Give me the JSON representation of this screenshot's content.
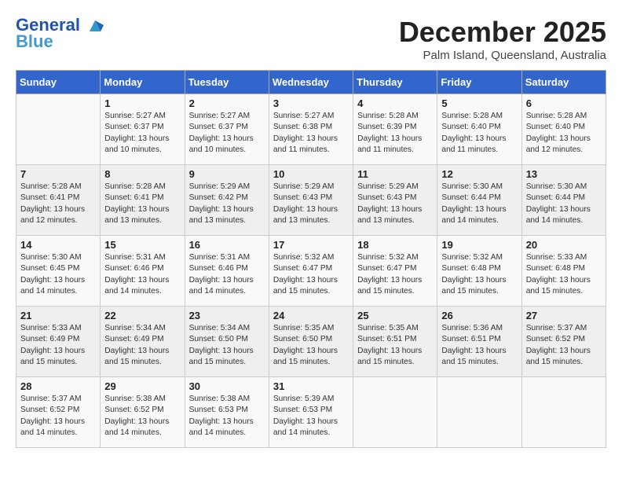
{
  "header": {
    "logo_line1": "General",
    "logo_line2": "Blue",
    "month": "December 2025",
    "location": "Palm Island, Queensland, Australia"
  },
  "weekdays": [
    "Sunday",
    "Monday",
    "Tuesday",
    "Wednesday",
    "Thursday",
    "Friday",
    "Saturday"
  ],
  "weeks": [
    [
      {
        "day": "",
        "info": ""
      },
      {
        "day": "1",
        "info": "Sunrise: 5:27 AM\nSunset: 6:37 PM\nDaylight: 13 hours\nand 10 minutes."
      },
      {
        "day": "2",
        "info": "Sunrise: 5:27 AM\nSunset: 6:37 PM\nDaylight: 13 hours\nand 10 minutes."
      },
      {
        "day": "3",
        "info": "Sunrise: 5:27 AM\nSunset: 6:38 PM\nDaylight: 13 hours\nand 11 minutes."
      },
      {
        "day": "4",
        "info": "Sunrise: 5:28 AM\nSunset: 6:39 PM\nDaylight: 13 hours\nand 11 minutes."
      },
      {
        "day": "5",
        "info": "Sunrise: 5:28 AM\nSunset: 6:40 PM\nDaylight: 13 hours\nand 11 minutes."
      },
      {
        "day": "6",
        "info": "Sunrise: 5:28 AM\nSunset: 6:40 PM\nDaylight: 13 hours\nand 12 minutes."
      }
    ],
    [
      {
        "day": "7",
        "info": "Sunrise: 5:28 AM\nSunset: 6:41 PM\nDaylight: 13 hours\nand 12 minutes."
      },
      {
        "day": "8",
        "info": "Sunrise: 5:28 AM\nSunset: 6:41 PM\nDaylight: 13 hours\nand 13 minutes."
      },
      {
        "day": "9",
        "info": "Sunrise: 5:29 AM\nSunset: 6:42 PM\nDaylight: 13 hours\nand 13 minutes."
      },
      {
        "day": "10",
        "info": "Sunrise: 5:29 AM\nSunset: 6:43 PM\nDaylight: 13 hours\nand 13 minutes."
      },
      {
        "day": "11",
        "info": "Sunrise: 5:29 AM\nSunset: 6:43 PM\nDaylight: 13 hours\nand 13 minutes."
      },
      {
        "day": "12",
        "info": "Sunrise: 5:30 AM\nSunset: 6:44 PM\nDaylight: 13 hours\nand 14 minutes."
      },
      {
        "day": "13",
        "info": "Sunrise: 5:30 AM\nSunset: 6:44 PM\nDaylight: 13 hours\nand 14 minutes."
      }
    ],
    [
      {
        "day": "14",
        "info": "Sunrise: 5:30 AM\nSunset: 6:45 PM\nDaylight: 13 hours\nand 14 minutes."
      },
      {
        "day": "15",
        "info": "Sunrise: 5:31 AM\nSunset: 6:46 PM\nDaylight: 13 hours\nand 14 minutes."
      },
      {
        "day": "16",
        "info": "Sunrise: 5:31 AM\nSunset: 6:46 PM\nDaylight: 13 hours\nand 14 minutes."
      },
      {
        "day": "17",
        "info": "Sunrise: 5:32 AM\nSunset: 6:47 PM\nDaylight: 13 hours\nand 15 minutes."
      },
      {
        "day": "18",
        "info": "Sunrise: 5:32 AM\nSunset: 6:47 PM\nDaylight: 13 hours\nand 15 minutes."
      },
      {
        "day": "19",
        "info": "Sunrise: 5:32 AM\nSunset: 6:48 PM\nDaylight: 13 hours\nand 15 minutes."
      },
      {
        "day": "20",
        "info": "Sunrise: 5:33 AM\nSunset: 6:48 PM\nDaylight: 13 hours\nand 15 minutes."
      }
    ],
    [
      {
        "day": "21",
        "info": "Sunrise: 5:33 AM\nSunset: 6:49 PM\nDaylight: 13 hours\nand 15 minutes."
      },
      {
        "day": "22",
        "info": "Sunrise: 5:34 AM\nSunset: 6:49 PM\nDaylight: 13 hours\nand 15 minutes."
      },
      {
        "day": "23",
        "info": "Sunrise: 5:34 AM\nSunset: 6:50 PM\nDaylight: 13 hours\nand 15 minutes."
      },
      {
        "day": "24",
        "info": "Sunrise: 5:35 AM\nSunset: 6:50 PM\nDaylight: 13 hours\nand 15 minutes."
      },
      {
        "day": "25",
        "info": "Sunrise: 5:35 AM\nSunset: 6:51 PM\nDaylight: 13 hours\nand 15 minutes."
      },
      {
        "day": "26",
        "info": "Sunrise: 5:36 AM\nSunset: 6:51 PM\nDaylight: 13 hours\nand 15 minutes."
      },
      {
        "day": "27",
        "info": "Sunrise: 5:37 AM\nSunset: 6:52 PM\nDaylight: 13 hours\nand 15 minutes."
      }
    ],
    [
      {
        "day": "28",
        "info": "Sunrise: 5:37 AM\nSunset: 6:52 PM\nDaylight: 13 hours\nand 14 minutes."
      },
      {
        "day": "29",
        "info": "Sunrise: 5:38 AM\nSunset: 6:52 PM\nDaylight: 13 hours\nand 14 minutes."
      },
      {
        "day": "30",
        "info": "Sunrise: 5:38 AM\nSunset: 6:53 PM\nDaylight: 13 hours\nand 14 minutes."
      },
      {
        "day": "31",
        "info": "Sunrise: 5:39 AM\nSunset: 6:53 PM\nDaylight: 13 hours\nand 14 minutes."
      },
      {
        "day": "",
        "info": ""
      },
      {
        "day": "",
        "info": ""
      },
      {
        "day": "",
        "info": ""
      }
    ]
  ]
}
